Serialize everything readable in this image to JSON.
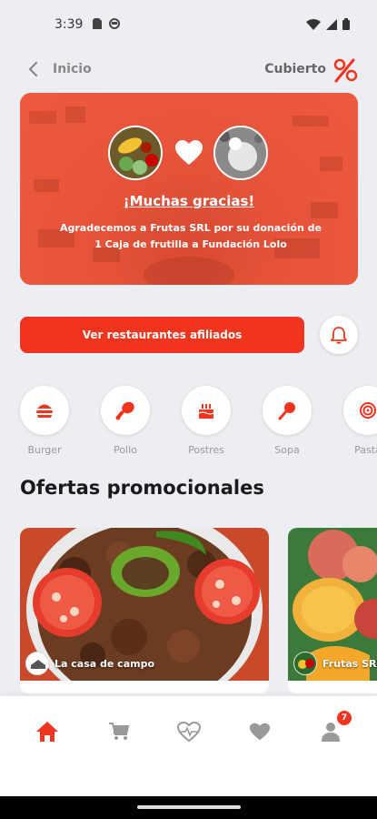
{
  "status": {
    "time": "3:39"
  },
  "header": {
    "back_label": "Inicio",
    "cubierto_label": "Cubierto"
  },
  "banner": {
    "title": "¡Muchas gracias!",
    "text": "Agradecemos a Frutas SRL por su donación de 1 Caja de frutilla a Fundación Lolo"
  },
  "actions": {
    "cta_label": "Ver restaurantes afiliados"
  },
  "categories": [
    {
      "label": "Burger",
      "icon": "burger-icon"
    },
    {
      "label": "Pollo",
      "icon": "chicken-leg-icon"
    },
    {
      "label": "Postres",
      "icon": "cake-icon"
    },
    {
      "label": "Sopa",
      "icon": "ladle-icon"
    },
    {
      "label": "Pasta",
      "icon": "pasta-icon"
    }
  ],
  "promos": {
    "title": "Ofertas promocionales",
    "cards": [
      {
        "name": "La casa de campo"
      },
      {
        "name": "Frutas SRL"
      }
    ]
  },
  "nav": {
    "profile_badge": "7"
  },
  "colors": {
    "accent": "#f0341d",
    "background": "#eceef3"
  }
}
